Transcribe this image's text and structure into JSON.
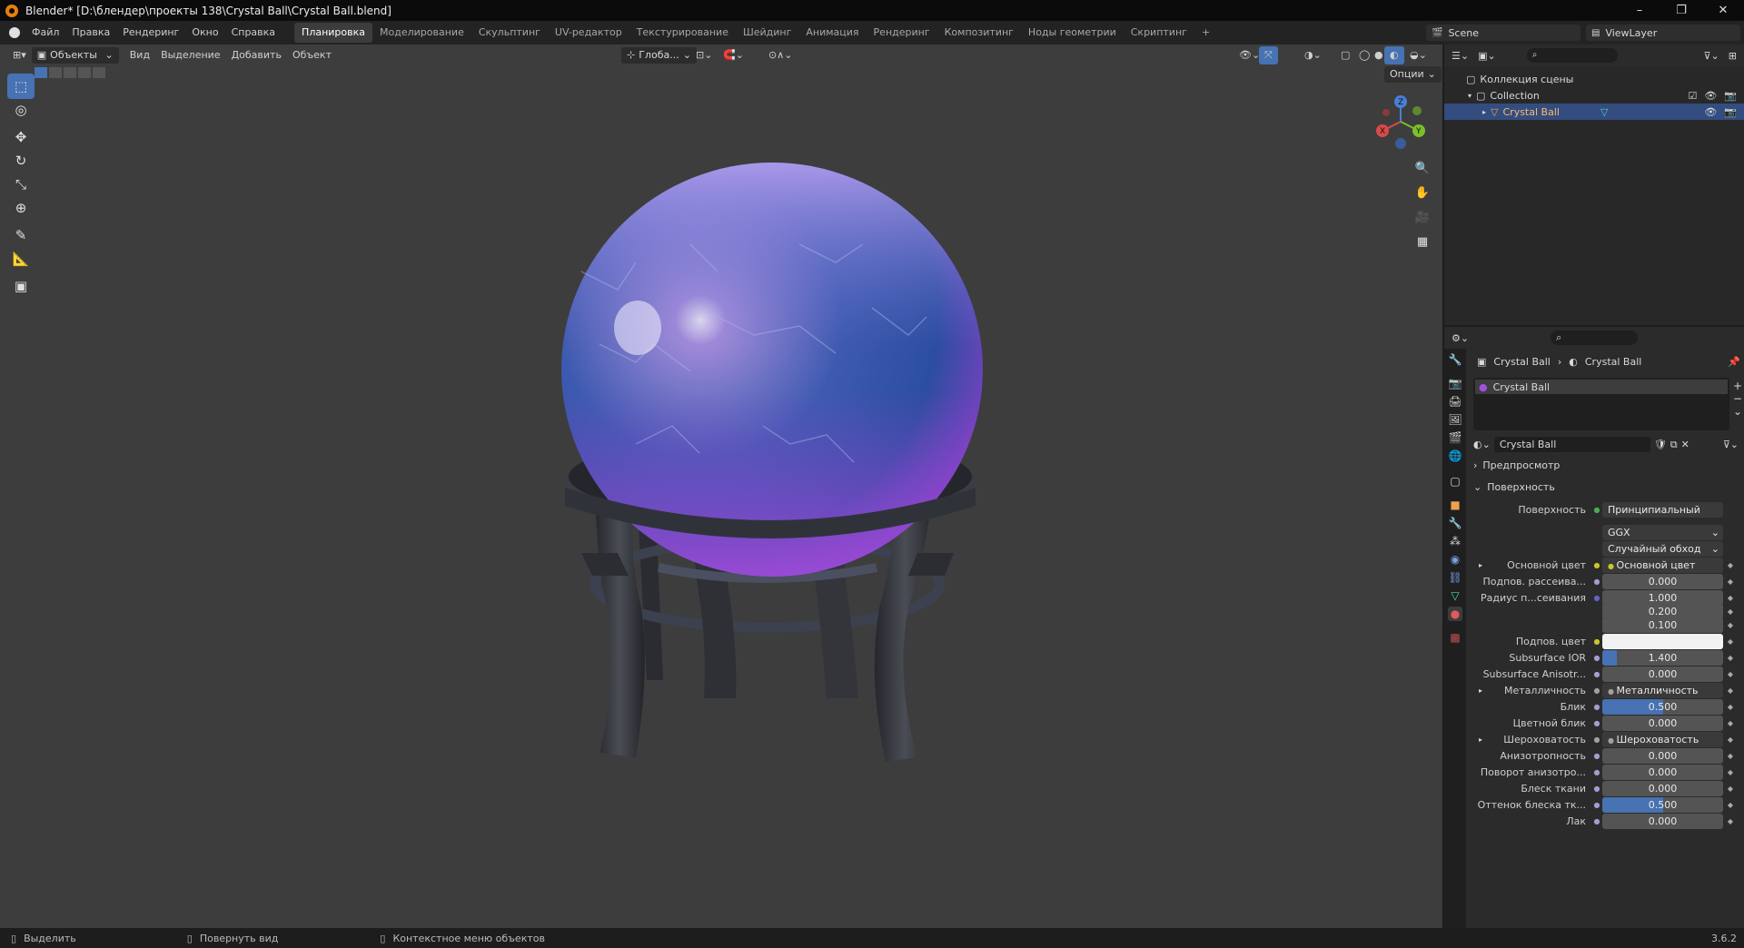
{
  "window": {
    "title": "Blender* [D:\\блендер\\проекты 138\\Crystal Ball\\Crystal Ball.blend]",
    "minimize": "–",
    "maximize": "❐",
    "close": "✕"
  },
  "menu": {
    "items": [
      "Файл",
      "Правка",
      "Рендеринг",
      "Окно",
      "Справка"
    ]
  },
  "workspaces": {
    "tabs": [
      "Планировка",
      "Моделирование",
      "Скульптинг",
      "UV-редактор",
      "Текстурирование",
      "Шейдинг",
      "Анимация",
      "Рендеринг",
      "Композитинг",
      "Ноды геометрии",
      "Скриптинг"
    ],
    "add": "+"
  },
  "scene": {
    "label": "Scene",
    "viewlayer": "ViewLayer"
  },
  "viewport": {
    "mode": "Объекты",
    "menus": [
      "Вид",
      "Выделение",
      "Добавить",
      "Объект"
    ],
    "orientation": "Глоба...",
    "options": "Опции"
  },
  "gizmo": {
    "x": "X",
    "y": "Y",
    "z": "Z"
  },
  "outliner": {
    "root": "Коллекция сцены",
    "collection": "Collection",
    "object": "Crystal Ball"
  },
  "properties": {
    "breadcrumb_obj": "Crystal Ball",
    "breadcrumb_mat": "Crystal Ball",
    "slot": "Crystal Ball",
    "material_name": "Crystal Ball",
    "preview": "Предпросмотр",
    "surface_panel": "Поверхность",
    "surface_label": "Поверхность",
    "surface_value": "Принципиальный BSDF",
    "distribution": "GGX",
    "subsurface_method": "Случайный обход",
    "rows": [
      {
        "label": "Основной цвет",
        "kind": "link",
        "value": "Основной цвет",
        "sock": "#c7c729"
      },
      {
        "label": "Подпов. рассеива...",
        "kind": "num",
        "value": "0.000",
        "fill": 0,
        "sock": "#a0a0d0"
      },
      {
        "label": "Радиус п...сеивания",
        "kind": "num",
        "value": "1.000",
        "fill": 0,
        "sock": "#6363c7"
      },
      {
        "label": "",
        "kind": "num",
        "value": "0.200",
        "fill": 0,
        "sock": ""
      },
      {
        "label": "",
        "kind": "num",
        "value": "0.100",
        "fill": 0,
        "sock": ""
      },
      {
        "label": "Подпов. цвет",
        "kind": "color",
        "value": "",
        "sock": "#c7c729"
      },
      {
        "label": "Subsurface IOR",
        "kind": "num",
        "value": "1.400",
        "fill": 0.12,
        "sock": "#a0a0d0"
      },
      {
        "label": "Subsurface Anisotr...",
        "kind": "num",
        "value": "0.000",
        "fill": 0,
        "sock": "#a0a0d0"
      },
      {
        "label": "Металличность",
        "kind": "link",
        "value": "Металличность",
        "sock": "#a0a0a0"
      },
      {
        "label": "Блик",
        "kind": "num",
        "value": "0.500",
        "fill": 0.5,
        "sock": "#a0a0d0"
      },
      {
        "label": "Цветной блик",
        "kind": "num",
        "value": "0.000",
        "fill": 0,
        "sock": "#a0a0d0"
      },
      {
        "label": "Шероховатость",
        "kind": "link",
        "value": "Шероховатость",
        "sock": "#a0a0a0"
      },
      {
        "label": "Анизотропность",
        "kind": "num",
        "value": "0.000",
        "fill": 0,
        "sock": "#a0a0d0"
      },
      {
        "label": "Поворот анизотро...",
        "kind": "num",
        "value": "0.000",
        "fill": 0,
        "sock": "#a0a0d0"
      },
      {
        "label": "Блеск ткани",
        "kind": "num",
        "value": "0.000",
        "fill": 0,
        "sock": "#a0a0d0"
      },
      {
        "label": "Оттенок блеска тк...",
        "kind": "num",
        "value": "0.500",
        "fill": 0.5,
        "sock": "#a0a0d0"
      },
      {
        "label": "Лак",
        "kind": "num",
        "value": "0.000",
        "fill": 0,
        "sock": "#a0a0d0"
      }
    ]
  },
  "status": {
    "select": "Выделить",
    "rotate": "Повернуть вид",
    "context": "Контекстное меню объектов",
    "version": "3.6.2"
  },
  "colors": {
    "accent": "#4772b3",
    "viewport_bg": "#3d3d3d",
    "sphere_top": "#8a6ad8",
    "sphere_mid": "#2f5aa8",
    "sphere_bottom": "#8e3ec8"
  }
}
